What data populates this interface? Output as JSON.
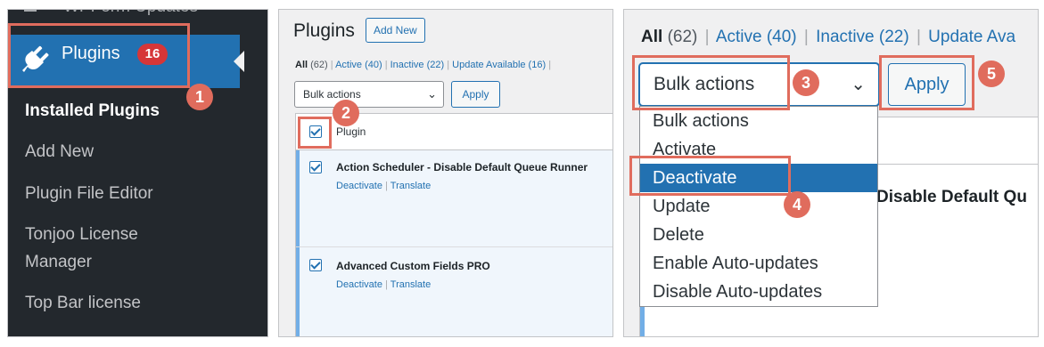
{
  "panel1": {
    "prev_menu_label": "WPForm Updates",
    "plugins_label": "Plugins",
    "plugins_count": "16",
    "submenu": [
      {
        "label": "Installed Plugins",
        "current": true
      },
      {
        "label": "Add New",
        "current": false
      },
      {
        "label": "Plugin File Editor",
        "current": false
      },
      {
        "label": "Tonjoo License",
        "current": false
      },
      {
        "label": "Manager",
        "current": false
      },
      {
        "label": "Top Bar license",
        "current": false
      }
    ]
  },
  "panel2": {
    "title": "Plugins",
    "add_new": "Add New",
    "filters": {
      "all": "All",
      "all_count": "(62)",
      "active": "Active (40)",
      "inactive": "Inactive (22)",
      "update": "Update Available (16)",
      "sep": "|"
    },
    "bulk_select": "Bulk actions",
    "apply": "Apply",
    "column_plugin": "Plugin",
    "rows": [
      {
        "name": "Action Scheduler - Disable Default Queue Runner",
        "action1": "Deactivate",
        "action2": "Translate"
      },
      {
        "name": "Advanced Custom Fields PRO",
        "action1": "Deactivate",
        "action2": "Translate"
      }
    ]
  },
  "panel3": {
    "filters": {
      "all": "All",
      "all_count": "(62)",
      "active": "Active (40)",
      "inactive": "Inactive (22)",
      "update": "Update Ava",
      "sep": "|"
    },
    "bulk_select": "Bulk actions",
    "apply": "Apply",
    "behind_text": "Disable Default Qu",
    "options": [
      {
        "label": "Bulk actions",
        "selected": false
      },
      {
        "label": "Activate",
        "selected": false
      },
      {
        "label": "Deactivate",
        "selected": true
      },
      {
        "label": "Update",
        "selected": false
      },
      {
        "label": "Delete",
        "selected": false
      },
      {
        "label": "Enable Auto-updates",
        "selected": false
      },
      {
        "label": "Disable Auto-updates",
        "selected": false
      }
    ]
  },
  "callouts": [
    "1",
    "2",
    "3",
    "4",
    "5"
  ],
  "colors": {
    "accent": "#2271b1",
    "callout": "#e06c5d",
    "sidebar_bg": "#23282d",
    "count_badge": "#d63638"
  },
  "icons": {
    "plugins_menu": "plug-icon",
    "dropdown": "chevron-down-icon",
    "checked": "checkbox-checked-icon"
  }
}
